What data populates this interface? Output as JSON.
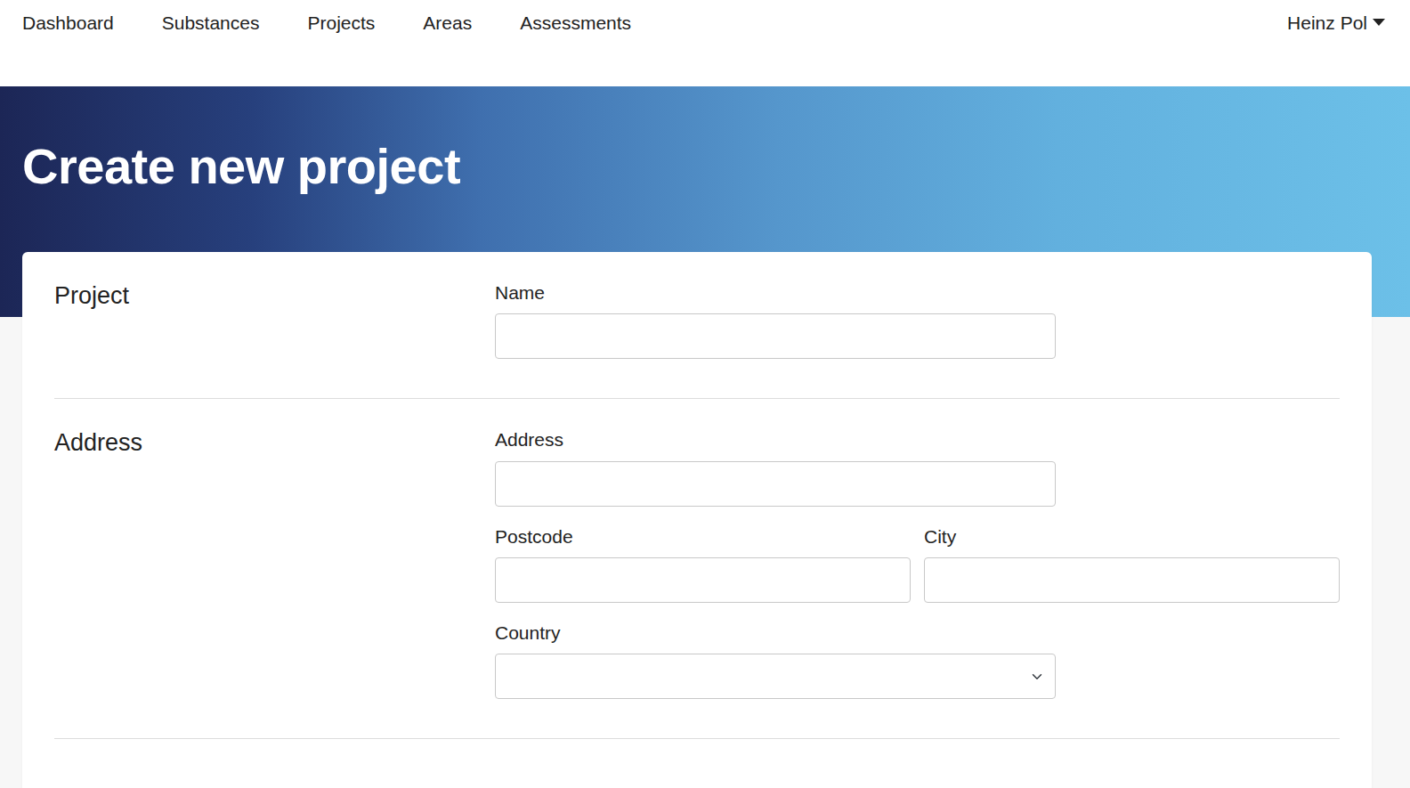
{
  "nav": {
    "items": [
      {
        "label": "Dashboard",
        "selected": false
      },
      {
        "label": "Substances",
        "selected": false
      },
      {
        "label": "Projects",
        "selected": false
      },
      {
        "label": "Areas",
        "selected": false
      },
      {
        "label": "Assessments",
        "selected": false
      }
    ],
    "user": {
      "label": "Heinz Pol",
      "expanded": false
    }
  },
  "hero": {
    "title": "Create new project"
  },
  "sections": [
    {
      "title": "Project",
      "rows": [
        [
          {
            "label": "Name",
            "kind": "text"
          }
        ]
      ]
    },
    {
      "title": "Address",
      "rows": [
        [
          {
            "label": "Address",
            "kind": "text"
          }
        ],
        [
          {
            "label": "Postcode",
            "kind": "text"
          },
          {
            "label": "City",
            "kind": "text"
          }
        ],
        [
          {
            "label": "Country",
            "kind": "select"
          }
        ]
      ]
    }
  ]
}
